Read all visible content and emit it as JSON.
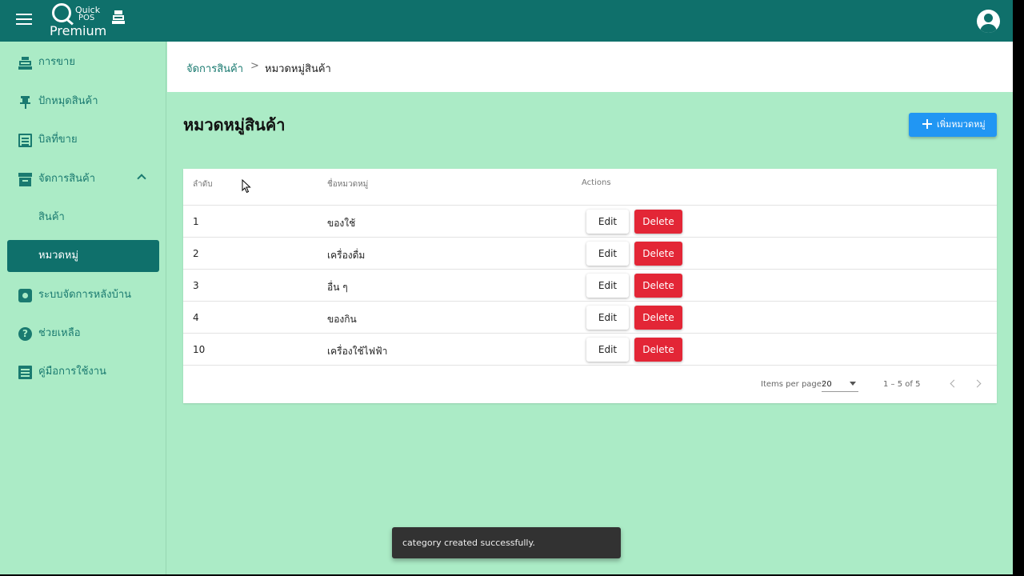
{
  "app": {
    "logo_quick": "Quick",
    "logo_pos": "POS",
    "logo_premium": "Premium",
    "icons": {
      "menu": "menu-icon",
      "register": "cash-register-icon",
      "account": "account-circle-icon"
    }
  },
  "sidebar": {
    "items": [
      {
        "label": "การขาย",
        "icon": "cash-register-icon"
      },
      {
        "label": "ปักหมุดสินค้า",
        "icon": "pin-icon"
      },
      {
        "label": "บิลที่ขาย",
        "icon": "receipt-icon"
      },
      {
        "label": "จัดการสินค้า",
        "icon": "archive-icon",
        "expanded": true
      },
      {
        "label": "สินค้า"
      },
      {
        "label": "หมวดหมู่",
        "active": true
      },
      {
        "label": "ระบบจัดการหลังบ้าน",
        "icon": "settings-icon"
      },
      {
        "label": "ช่วยเหลือ",
        "icon": "help-icon"
      },
      {
        "label": "คู่มือการใช้งาน",
        "icon": "document-icon"
      }
    ]
  },
  "breadcrumb": {
    "parent": "จัดการสินค้า",
    "separator": ">",
    "current": "หมวดหมู่สินค้า"
  },
  "page": {
    "title": "หมวดหมู่สินค้า",
    "add_button": "เพิ่มหมวดหมู่"
  },
  "table": {
    "headers": {
      "index": "ลำดับ",
      "name": "ชื่อหมวดหมู่",
      "actions": "Actions"
    },
    "edit_label": "Edit",
    "delete_label": "Delete",
    "rows": [
      {
        "id": "1",
        "name": "ของใช้"
      },
      {
        "id": "2",
        "name": "เครื่องดื่ม"
      },
      {
        "id": "3",
        "name": "อื่น ๆ"
      },
      {
        "id": "4",
        "name": "ของกิน"
      },
      {
        "id": "10",
        "name": "เครื่องใช้ไฟฟ้า"
      }
    ]
  },
  "pagination": {
    "items_per_page_label": "Items per page:",
    "items_per_page": "20",
    "range": "1 – 5 of 5"
  },
  "toast": {
    "message": "category created successfully."
  },
  "colors": {
    "toolbar": "#0f706b",
    "background": "#abebc6",
    "primary_button": "#2196f3",
    "delete_button": "#e32636",
    "toast": "#323232"
  }
}
